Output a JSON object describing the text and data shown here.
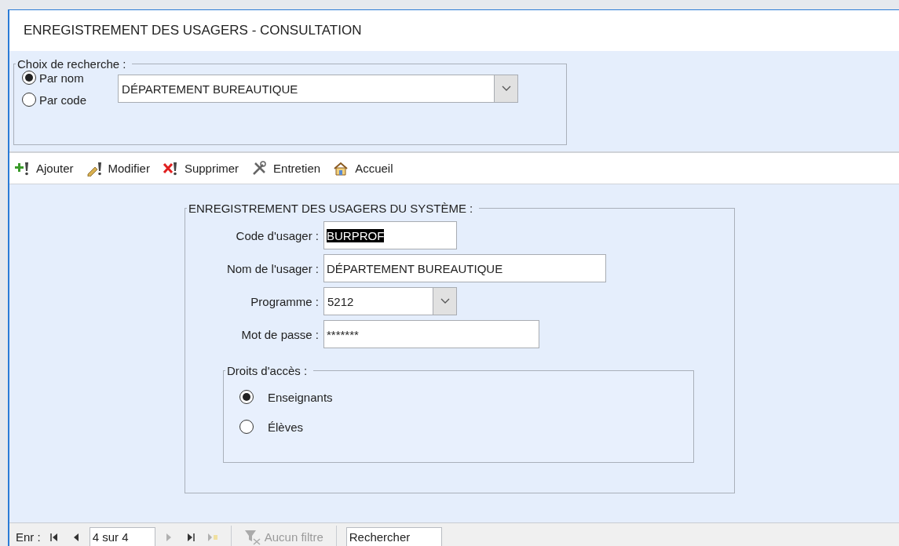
{
  "window": {
    "title": "ENREGISTREMENT DES USAGERS - CONSULTATION"
  },
  "search": {
    "legend": "Choix de recherche :",
    "options": [
      {
        "label": "Par nom",
        "selected": true
      },
      {
        "label": "Par code",
        "selected": false
      }
    ],
    "value": "DÉPARTEMENT BUREAUTIQUE"
  },
  "toolbar": [
    {
      "kind": "add",
      "label": "Ajouter"
    },
    {
      "kind": "edit",
      "label": "Modifier"
    },
    {
      "kind": "delete",
      "label": "Supprimer"
    },
    {
      "kind": "tools",
      "label": "Entretien"
    },
    {
      "kind": "home",
      "label": "Accueil"
    }
  ],
  "form": {
    "legend": "ENREGISTREMENT DES USAGERS DU SYSTÈME :",
    "fields": [
      {
        "kind": "text",
        "label": "Code d'usager :",
        "value": "BURPROF",
        "selected": true
      },
      {
        "kind": "text",
        "label": "Nom de l'usager :",
        "value": "DÉPARTEMENT BUREAUTIQUE",
        "selected": false
      },
      {
        "kind": "combo",
        "label": "Programme :",
        "value": "5212",
        "selected": false
      },
      {
        "kind": "password",
        "label": "Mot de passe :",
        "value": "*******",
        "selected": false
      }
    ],
    "rights": {
      "legend": "Droits d'accès :",
      "options": [
        {
          "label": "Enseignants",
          "selected": true
        },
        {
          "label": "Élèves",
          "selected": false
        }
      ]
    }
  },
  "status_bar": {
    "label": "Enr :",
    "nav": [
      {
        "kind": "first",
        "disabled": false
      },
      {
        "kind": "prev",
        "disabled": false
      },
      {
        "kind": "record",
        "value": "4 sur 4"
      },
      {
        "kind": "next",
        "disabled": true
      },
      {
        "kind": "last",
        "disabled": false
      },
      {
        "kind": "new",
        "disabled": true
      }
    ],
    "filter": {
      "label": "Aucun filtre",
      "disabled": true
    },
    "search_box": "Rechercher"
  }
}
